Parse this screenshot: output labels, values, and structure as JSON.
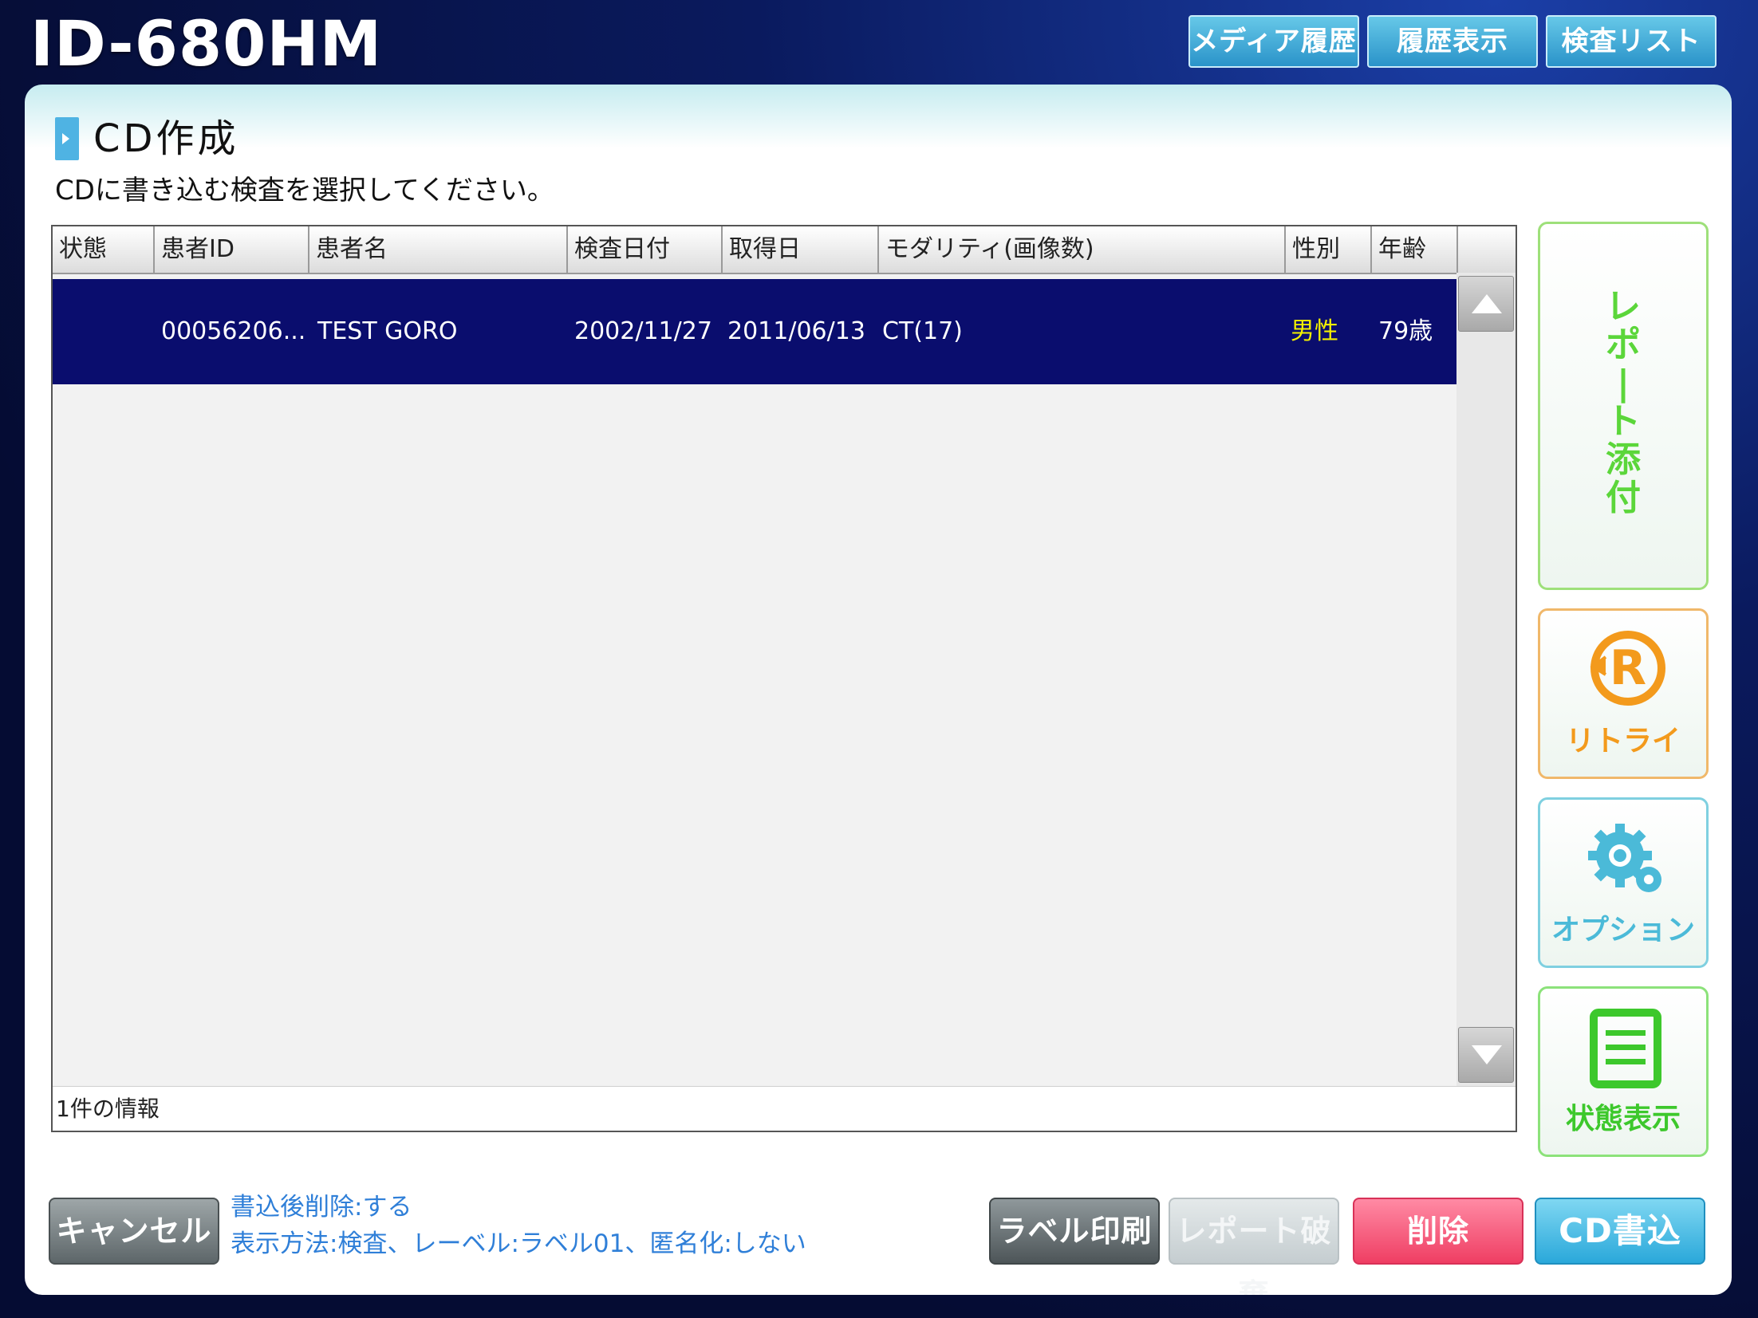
{
  "header": {
    "app_title": "ID-680HM",
    "buttons": [
      "メディア履歴",
      "履歴表示",
      "検査リスト"
    ]
  },
  "section": {
    "title": "CD作成",
    "instruction": "CDに書き込む検査を選択してください。"
  },
  "table": {
    "columns": [
      "状態",
      "患者ID",
      "患者名",
      "検査日付",
      "取得日",
      "モダリティ(画像数)",
      "性別",
      "年齢"
    ],
    "rows": [
      {
        "status": "",
        "patient_id": "00056206...",
        "patient_name": "TEST GORO",
        "exam_date": "2002/11/27",
        "acquired_date": "2011/06/13",
        "modality": "CT(17)",
        "sex": "男性",
        "age": "79歳"
      }
    ],
    "selected_row": 0,
    "footer": "1件の情報"
  },
  "side_buttons": {
    "report_attach": "レポート添付",
    "retry": "リトライ",
    "option": "オプション",
    "status_view": "状態表示"
  },
  "bottom": {
    "cancel": "キャンセル",
    "settings_line1": "書込後削除:する",
    "settings_line2": "表示方法:検査、レーベル:ラベル01、匿名化:しない",
    "label_print": "ラベル印刷",
    "report_discard": "レポート破棄",
    "delete": "削除",
    "cd_write": "CD書込"
  },
  "colors": {
    "selected_row": "#0a0d6e",
    "report_green": "#5bd63a",
    "retry_orange": "#f39a1c",
    "option_blue": "#4bbad8",
    "delete_pink": "#ef3e63",
    "cd_write_blue": "#2aa8da"
  },
  "icons": {
    "retry": "retry-r-icon",
    "option": "gear-icon",
    "status_view": "list-icon",
    "scroll_up": "arrow-up-icon",
    "scroll_down": "arrow-down-icon"
  }
}
